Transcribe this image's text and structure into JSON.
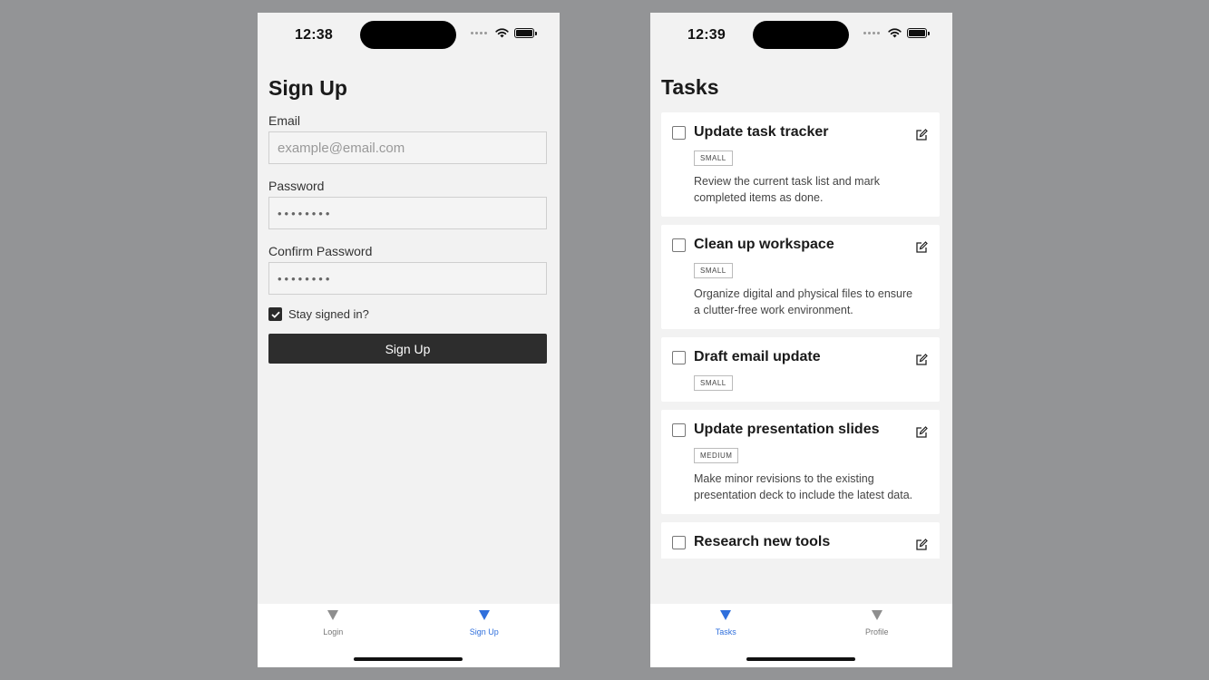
{
  "signup_screen": {
    "status_time": "12:38",
    "title": "Sign Up",
    "email": {
      "label": "Email",
      "placeholder": "example@email.com"
    },
    "password": {
      "label": "Password",
      "value": "••••••••"
    },
    "confirm_password": {
      "label": "Confirm Password",
      "value": "••••••••"
    },
    "stay_signed_in": {
      "label": "Stay signed in?",
      "checked": true
    },
    "submit_label": "Sign Up",
    "tabs": [
      {
        "label": "Login",
        "active": false
      },
      {
        "label": "Sign Up",
        "active": true
      }
    ]
  },
  "tasks_screen": {
    "status_time": "12:39",
    "title": "Tasks",
    "tasks": [
      {
        "title": "Update task tracker",
        "size": "SMALL",
        "description": "Review the current task list and mark completed items as done."
      },
      {
        "title": "Clean up workspace",
        "size": "SMALL",
        "description": "Organize digital and physical files to ensure a clutter-free work environment."
      },
      {
        "title": "Draft email update",
        "size": "SMALL",
        "description": ""
      },
      {
        "title": "Update presentation slides",
        "size": "MEDIUM",
        "description": "Make minor revisions to the existing presentation deck to include the latest data."
      },
      {
        "title": "Research new tools",
        "size": "",
        "description": ""
      }
    ],
    "tabs": [
      {
        "label": "Tasks",
        "active": true
      },
      {
        "label": "Profile",
        "active": false
      }
    ]
  },
  "colors": {
    "background": "#939496",
    "screen": "#f2f2f2",
    "accent": "#2f6fdc",
    "primary_button": "#2d2d2d"
  }
}
